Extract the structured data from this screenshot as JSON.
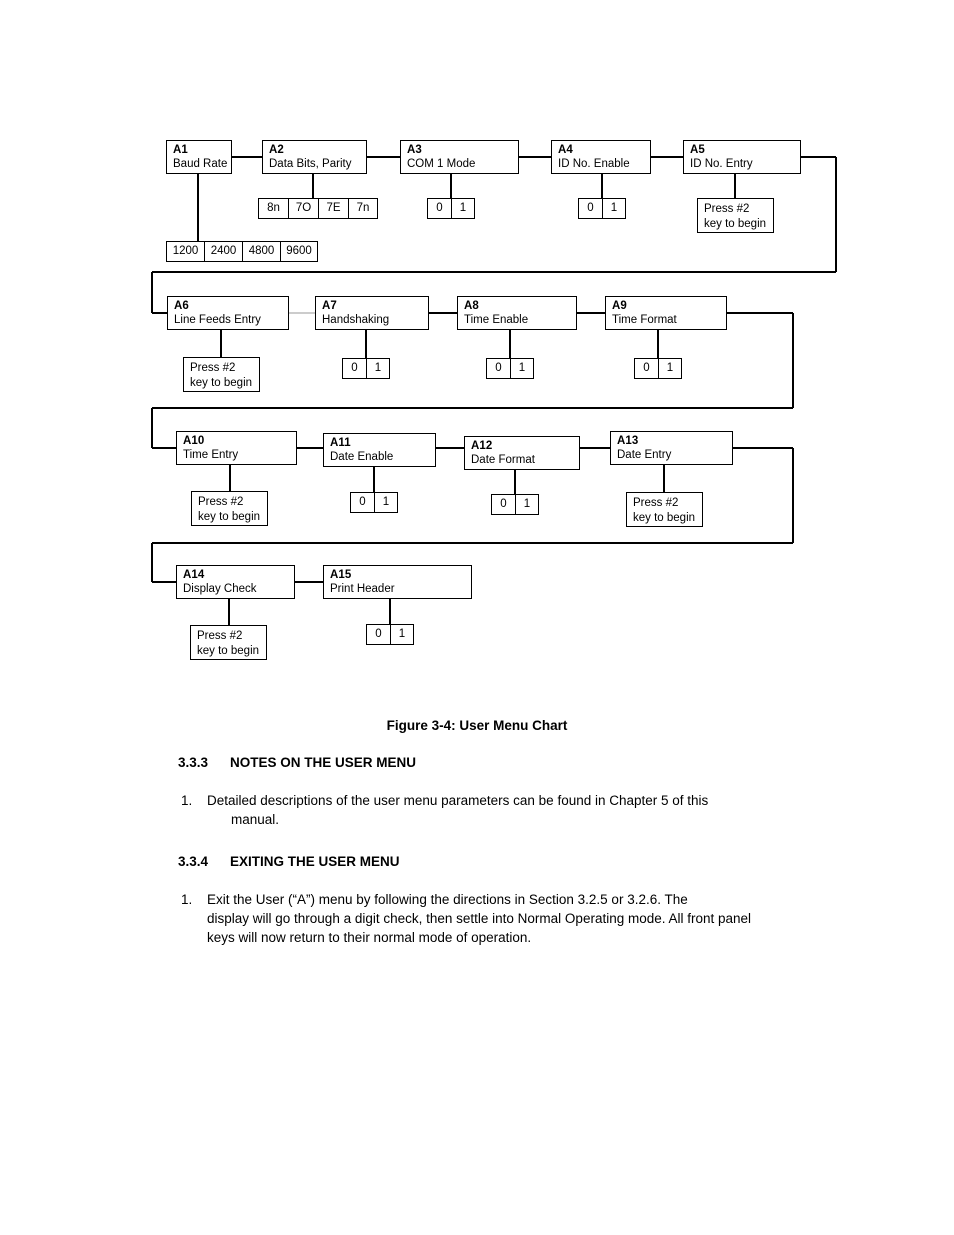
{
  "figure": {
    "caption": "Figure 3-4: User Menu Chart",
    "rows": [
      {
        "nodes": [
          {
            "code": "A1",
            "name": "Baud Rate",
            "options": [
              "1200",
              "2400",
              "4800",
              "9600"
            ],
            "option_style": "baud",
            "press": null
          },
          {
            "code": "A2",
            "name": "Data Bits, Parity",
            "options": [
              "8n",
              "7O",
              "7E",
              "7n"
            ],
            "option_style": "parity",
            "press": null
          },
          {
            "code": "A3",
            "name": "COM 1 Mode",
            "options": [
              "0",
              "1"
            ],
            "option_style": "bin",
            "press": null
          },
          {
            "code": "A4",
            "name": "ID No. Enable",
            "options": [
              "0",
              "1"
            ],
            "option_style": "bin",
            "press": null
          },
          {
            "code": "A5",
            "name": "ID No. Entry",
            "options": null,
            "option_style": null,
            "press": [
              "Press #2",
              "key to begin"
            ]
          }
        ]
      },
      {
        "nodes": [
          {
            "code": "A6",
            "name": "Line Feeds Entry",
            "options": null,
            "option_style": null,
            "press": [
              "Press #2",
              "key to begin"
            ]
          },
          {
            "code": "A7",
            "name": "Handshaking",
            "options": [
              "0",
              "1"
            ],
            "option_style": "bin",
            "press": null
          },
          {
            "code": "A8",
            "name": "Time Enable",
            "options": [
              "0",
              "1"
            ],
            "option_style": "bin",
            "press": null
          },
          {
            "code": "A9",
            "name": "Time Format",
            "options": [
              "0",
              "1"
            ],
            "option_style": "bin",
            "press": null
          }
        ]
      },
      {
        "nodes": [
          {
            "code": "A10",
            "name": "Time Entry",
            "options": null,
            "option_style": null,
            "press": [
              "Press #2",
              "key to begin"
            ]
          },
          {
            "code": "A11",
            "name": "Date Enable",
            "options": [
              "0",
              "1"
            ],
            "option_style": "bin",
            "press": null
          },
          {
            "code": "A12",
            "name": "Date Format",
            "options": [
              "0",
              "1"
            ],
            "option_style": "bin",
            "press": null
          },
          {
            "code": "A13",
            "name": "Date Entry",
            "options": null,
            "option_style": null,
            "press": [
              "Press #2",
              "key to begin"
            ]
          }
        ]
      },
      {
        "nodes": [
          {
            "code": "A14",
            "name": "Display Check",
            "options": null,
            "option_style": null,
            "press": [
              "Press #2",
              "key to begin"
            ]
          },
          {
            "code": "A15",
            "name": "Print Header",
            "options": [
              "0",
              "1"
            ],
            "option_style": "bin",
            "press": null
          }
        ]
      }
    ]
  },
  "sections": [
    {
      "number": "3.3.3",
      "title": "NOTES ON THE USER MENU",
      "items": [
        {
          "marker": "1.",
          "line1": "Detailed descriptions of the user menu parameters can be found in Chapter 5 of this",
          "line2": "manual.",
          "line3": ""
        }
      ]
    },
    {
      "number": "3.3.4",
      "title": "EXITING THE USER MENU",
      "items": [
        {
          "marker": "1.",
          "line1": "Exit the User (“A”) menu by following the directions in Section 3.2.5 or 3.2.6. The",
          "line2": "display will go through a digit check, then settle into Normal Operating mode. All front panel",
          "line3": "keys will now return to their normal mode of operation."
        }
      ]
    }
  ]
}
